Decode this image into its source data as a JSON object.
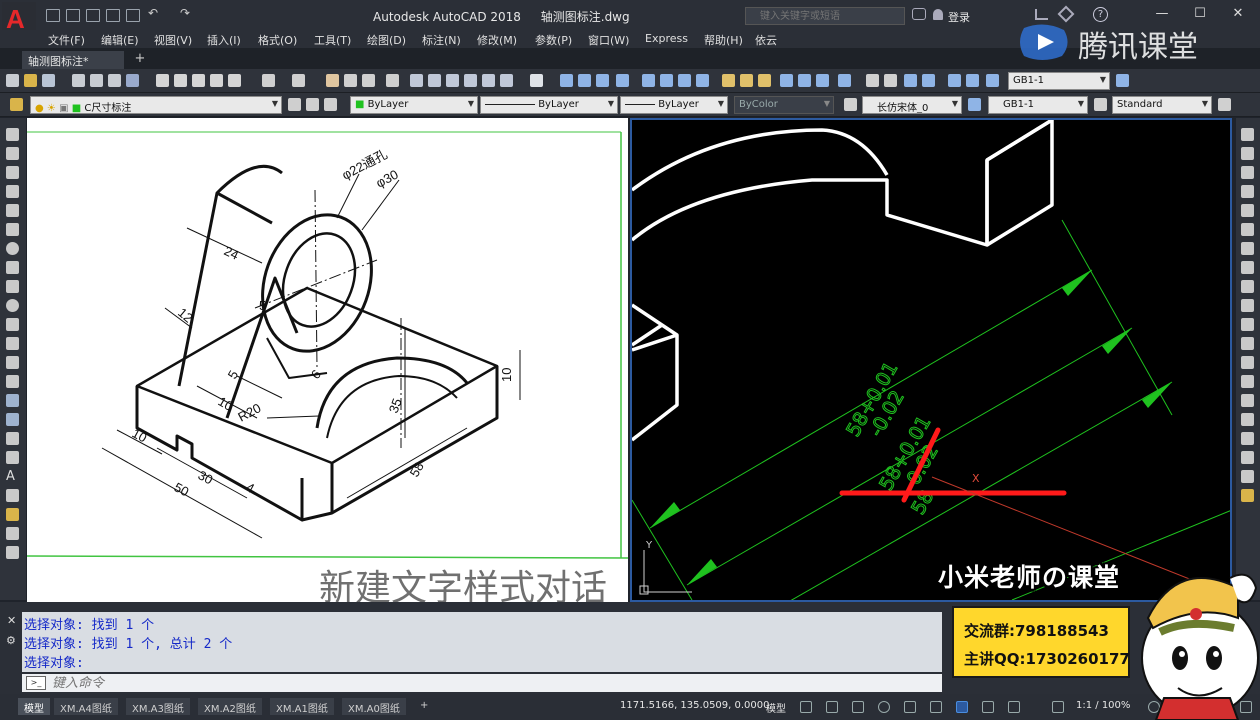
{
  "titlebar": {
    "app_name": "Autodesk AutoCAD 2018",
    "file_name": "轴测图标注.dwg",
    "search_placeholder": "键入关键字或短语",
    "signin_label": "登录",
    "min": "—",
    "max": "☐",
    "close": "✕"
  },
  "menu": [
    "文件(F)",
    "编辑(E)",
    "视图(V)",
    "插入(I)",
    "格式(O)",
    "工具(T)",
    "绘图(D)",
    "标注(N)",
    "修改(M)",
    "参数(P)",
    "窗口(W)",
    "Express",
    "帮助(H)",
    "依云"
  ],
  "tabs": {
    "doc_tab": "轴测图标注*",
    "add": "+"
  },
  "toolbar1": {
    "dimstyle_combo": "GB1-1"
  },
  "toolbar2": {
    "layer_combo": "C尺寸标注",
    "color_combo": "ByLayer",
    "linetype_combo": "ByLayer",
    "lineweight_combo": "ByLayer",
    "plotstyle_combo": "ByColor",
    "textstyle_combo": "长仿宋体_0",
    "dimstyle2_combo": "GB1-1",
    "tablestyle_combo": "Standard"
  },
  "reference_drawing": {
    "labels": [
      "φ22通孔",
      "φ30",
      "24",
      "12",
      "5",
      "5",
      "10",
      "R20",
      "35",
      "10",
      "10",
      "30",
      "50",
      "4",
      "58",
      "6"
    ],
    "overlay_text": "新建文字样式对话"
  },
  "model_space": {
    "dim_texts": [
      "58+0.01",
      "-0.02",
      "58+0.01",
      "-0.02",
      "58"
    ],
    "axis_x": "X",
    "axis_y": "Y"
  },
  "command": {
    "history": [
      "选择对象: 找到 1 个",
      "选择对象: 找到 1 个, 总计 2 个",
      "选择对象:"
    ],
    "input_placeholder": "键入命令",
    "prompt_icon": ">_"
  },
  "statusbar": {
    "layout_tabs": [
      "模型",
      "XM.A4图纸",
      "XM.A3图纸",
      "XM.A2图纸",
      "XM.A1图纸",
      "XM.A0图纸"
    ],
    "tab_add": "+",
    "coords": "1171.5166, 135.0509, 0.0000",
    "model_label": "模型",
    "scale": "1:1 / 100%"
  },
  "watermark": {
    "text": "腾讯课堂"
  },
  "teacher_badge": {
    "title": "小米老师の课堂",
    "group_line": "交流群:798188543",
    "qq_line": "主讲QQ:1730260177"
  },
  "colors": {
    "dimension_green": "#1fc21f",
    "highlight_red": "#ff1a1a",
    "outline_white": "#ffffff",
    "ucs_red": "#c0392b",
    "badge_yellow": "#ffd72c",
    "command_blue": "#1428c8"
  }
}
